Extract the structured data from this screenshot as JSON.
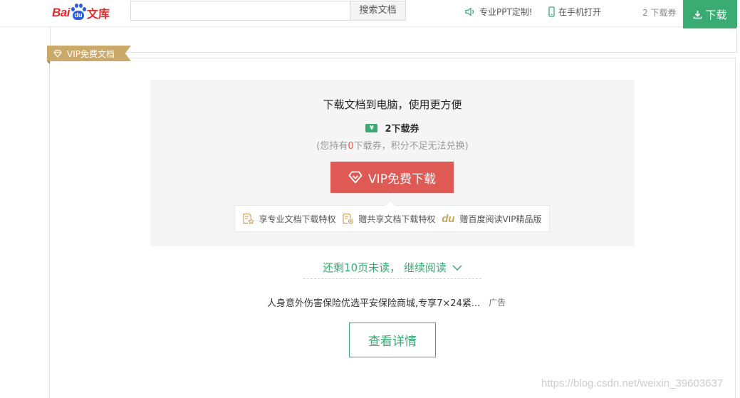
{
  "header": {
    "logo": {
      "bai": "Bai",
      "du": "du",
      "wenku": "文库"
    },
    "search": {
      "value": "",
      "placeholder": "",
      "button_label": "搜索文档"
    },
    "ppt_link": "专业PPT定制!",
    "mobile_link": "在手机打开",
    "coupon_count": "2 下载券",
    "download_label": "下载"
  },
  "vip_ribbon": "VIP免费文档",
  "download_panel": {
    "title": "下载文档到电脑，使用更方便",
    "coupon_icon_text": "¥",
    "coupon_cost": "2下载券",
    "hold_prefix": "(您持有",
    "hold_count": "0",
    "hold_suffix": "下载券，积分不足无法兑换)",
    "vip_button": "VIP免费下载",
    "privileges": [
      {
        "icon": "doc-star-icon",
        "label": "享专业文档下载特权"
      },
      {
        "icon": "doc-share-icon",
        "label": "赠共享文档下载特权"
      },
      {
        "icon": "du-reading-logo",
        "logo_text": "du",
        "label": "赠百度阅读VIP精品版"
      }
    ]
  },
  "continue_reading": "还剩10页未读， 继续阅读",
  "ad": {
    "text": "人身意外伤害保险优选平安保险商城,专享7×24紧...",
    "tag": "广告"
  },
  "detail_button": "查看详情",
  "watermark": "https://blog.csdn.net/weixin_39603637",
  "colors": {
    "green": "#3aab72",
    "red_button": "#e05a55",
    "gold": "#caa96a",
    "panel_bg": "#f5f5f5"
  }
}
